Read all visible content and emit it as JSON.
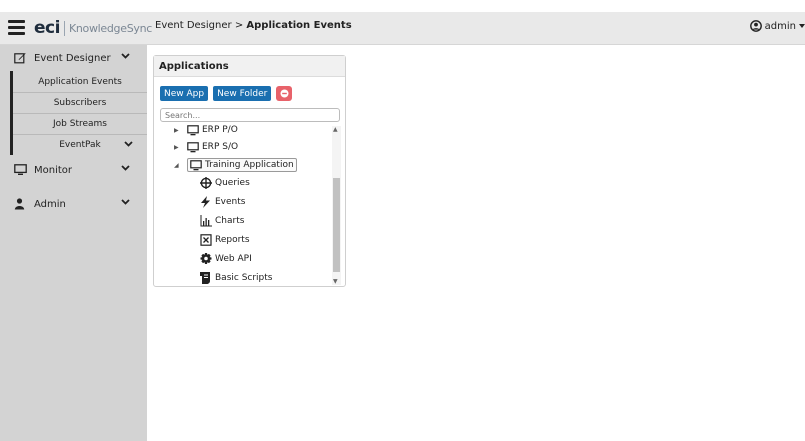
{
  "header": {
    "logo_eci": "eci",
    "logo_product": "KnowledgeSync",
    "breadcrumb_parent": "Event Designer",
    "breadcrumb_sep": ">",
    "breadcrumb_current": "Application Events",
    "user": "admin"
  },
  "sidebar": {
    "event_designer": {
      "label": "Event Designer",
      "icon": "edit-icon",
      "items": [
        "Application Events",
        "Subscribers",
        "Job Streams",
        "EventPak"
      ]
    },
    "monitor": {
      "label": "Monitor",
      "icon": "monitor-icon"
    },
    "admin": {
      "label": "Admin",
      "icon": "user-icon"
    }
  },
  "panel": {
    "title": "Applications",
    "new_app": "New App",
    "new_folder": "New Folder",
    "search_placeholder": "Search..."
  },
  "tree": {
    "nodes": [
      {
        "label": "ERP P/O",
        "icon": "monitor-icon",
        "expanded": false
      },
      {
        "label": "ERP S/O",
        "icon": "monitor-icon",
        "expanded": false
      },
      {
        "label": "Training Application",
        "icon": "monitor-icon",
        "expanded": true,
        "selected": true,
        "children": [
          {
            "label": "Queries",
            "icon": "crosshair-icon"
          },
          {
            "label": "Events",
            "icon": "lightning-icon"
          },
          {
            "label": "Charts",
            "icon": "bar-chart-icon"
          },
          {
            "label": "Reports",
            "icon": "report-icon"
          },
          {
            "label": "Web API",
            "icon": "gear-icon"
          },
          {
            "label": "Basic Scripts",
            "icon": "scroll-icon"
          }
        ]
      }
    ]
  },
  "colors": {
    "primary_button": "#1a6fb0",
    "delete_button": "#e8626a",
    "sidebar_bg": "#d3d3d3",
    "topbar_bg": "#e9e9e9"
  }
}
